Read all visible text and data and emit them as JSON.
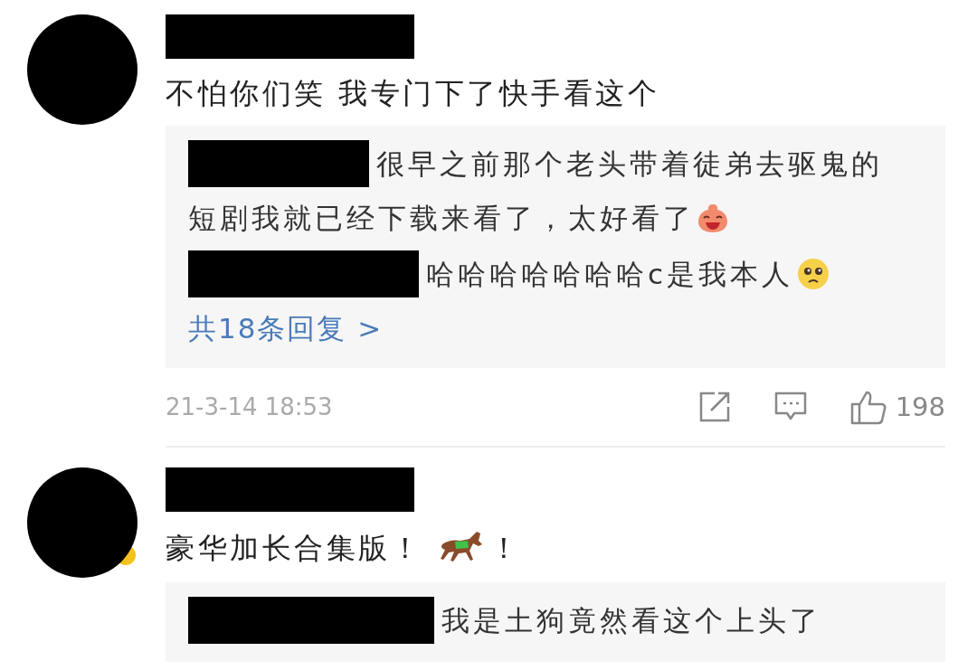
{
  "comments": [
    {
      "avatar_badge": false,
      "segments": [
        {
          "kind": "text",
          "text": "不怕你们笑 我专门下了快手看这个"
        }
      ],
      "replies": [
        {
          "lines": [
            [
              {
                "kind": "text",
                "text": "很早之前那个老头带着徒弟去驱鬼的"
              }
            ],
            [
              {
                "kind": "text",
                "text": "短剧我就已经下载来看了，太好看了"
              },
              {
                "kind": "laughing"
              }
            ]
          ]
        },
        {
          "lines": [
            [
              {
                "kind": "text",
                "text": "哈哈哈哈哈哈哈c是我本人"
              },
              {
                "kind": "pleading"
              }
            ]
          ]
        }
      ],
      "more_replies": "共18条回复 >",
      "time": "21-3-14 18:53",
      "likes": "198"
    },
    {
      "avatar_badge": true,
      "segments": [
        {
          "kind": "text",
          "text": "豪华加长合集版！"
        },
        {
          "kind": "horse"
        },
        {
          "kind": "text",
          "text": "！"
        }
      ],
      "replies": [
        {
          "lines": [
            [
              {
                "kind": "text",
                "text": "我是土狗竟然看这个上头了"
              }
            ]
          ]
        }
      ]
    }
  ]
}
